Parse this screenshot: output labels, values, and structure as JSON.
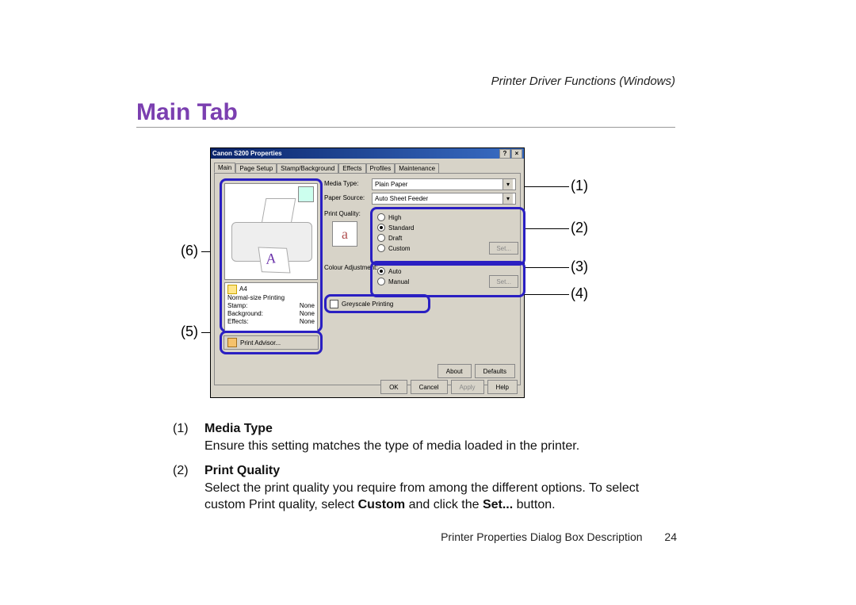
{
  "running_head": "Printer Driver Functions (Windows)",
  "title": "Main Tab",
  "dialog": {
    "title": "Canon S200 Properties",
    "tabs": [
      "Main",
      "Page Setup",
      "Stamp/Background",
      "Effects",
      "Profiles",
      "Maintenance"
    ],
    "media_type": {
      "label": "Media Type:",
      "value": "Plain Paper"
    },
    "paper_source": {
      "label": "Paper Source:",
      "value": "Auto Sheet Feeder"
    },
    "print_quality": {
      "label": "Print Quality:",
      "options": [
        "High",
        "Standard",
        "Draft",
        "Custom"
      ],
      "selected": "Standard",
      "set": "Set..."
    },
    "colour_adjustment": {
      "label": "Colour Adjustment:",
      "options": [
        "Auto",
        "Manual"
      ],
      "selected": "Auto",
      "set": "Set..."
    },
    "greyscale": {
      "label": "Greyscale Printing"
    },
    "preview_info": {
      "page_size": "A4",
      "scaling": "Normal-size Printing",
      "rows": [
        {
          "k": "Stamp:",
          "v": "None"
        },
        {
          "k": "Background:",
          "v": "None"
        },
        {
          "k": "Effects:",
          "v": "None"
        }
      ]
    },
    "advisor": "Print Advisor...",
    "buttons_mid": [
      "About",
      "Defaults"
    ],
    "buttons_bottom": [
      "OK",
      "Cancel",
      "Apply",
      "Help"
    ]
  },
  "callouts": {
    "1": "(1)",
    "2": "(2)",
    "3": "(3)",
    "4": "(4)",
    "5": "(5)",
    "6": "(6)"
  },
  "descriptions": [
    {
      "num": "(1)",
      "heading": "Media Type",
      "body": "Ensure this setting matches the type of media loaded in the printer."
    },
    {
      "num": "(2)",
      "heading": "Print Quality",
      "body": "Select the print quality you require from among the different options. To select custom Print quality, select ",
      "bold1": "Custom",
      "mid": " and click the ",
      "bold2": "Set...",
      "end": " button."
    }
  ],
  "footer": {
    "text": "Printer Properties Dialog Box Description",
    "page": "24"
  }
}
